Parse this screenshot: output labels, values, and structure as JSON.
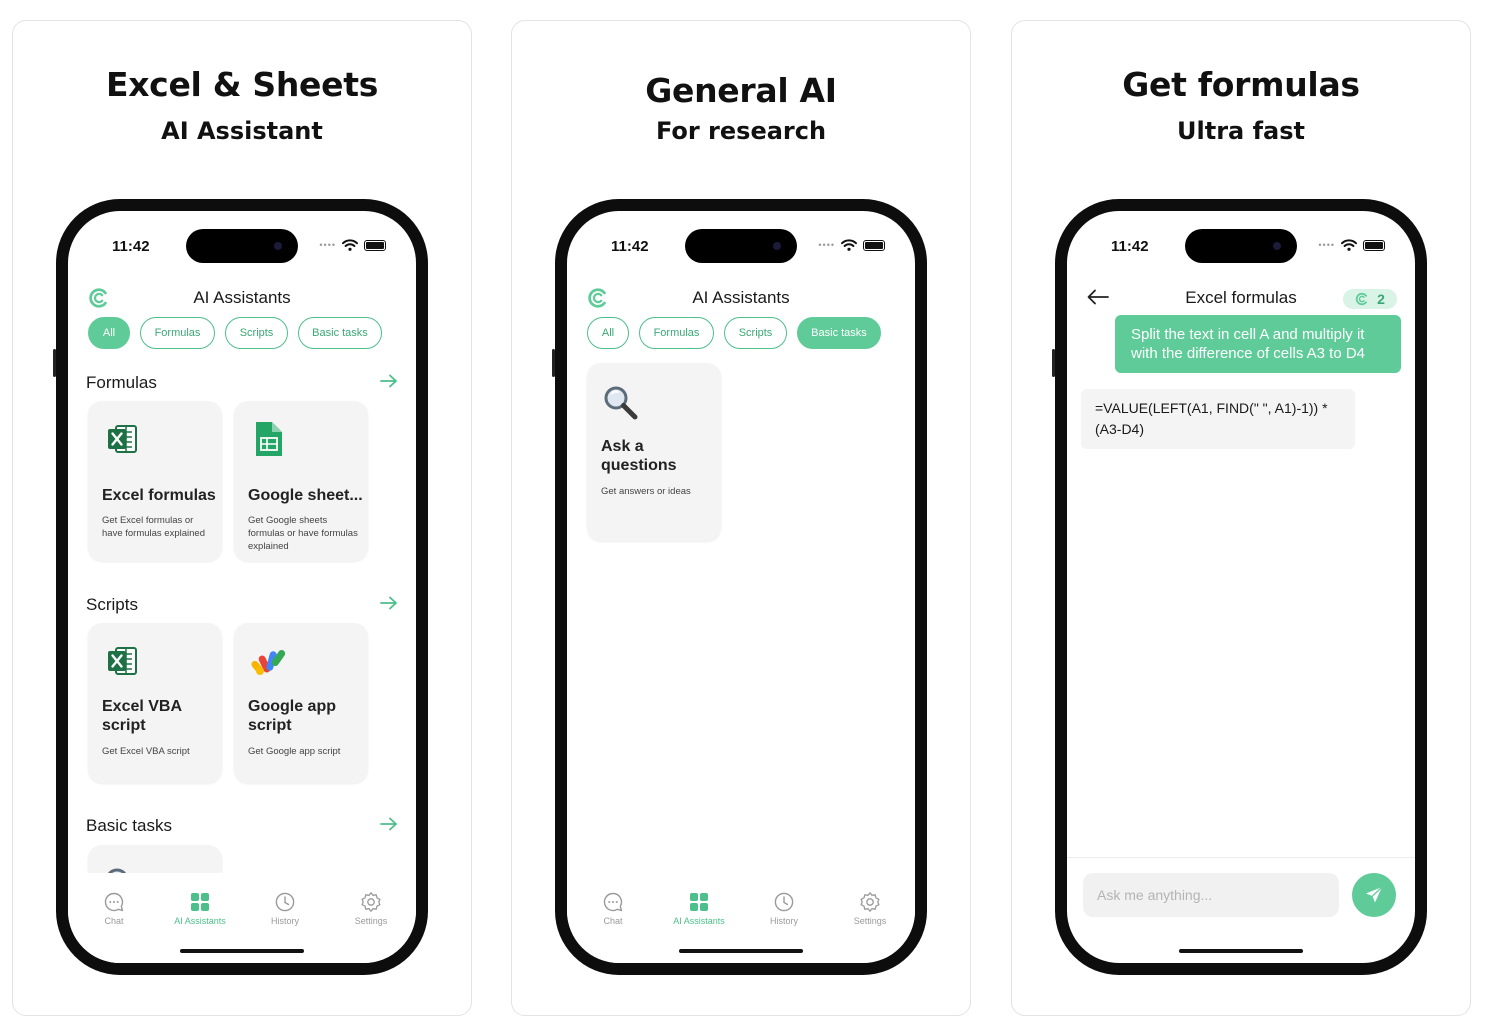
{
  "colors": {
    "accent": "#5ecb98",
    "accent_dark": "#3aa876",
    "tile_bg": "#f4f4f4"
  },
  "status_time": "11:42",
  "panels": [
    {
      "headline": "Excel & Sheets",
      "subheadline": "AI Assistant",
      "screen_title": "AI Assistants",
      "chips": [
        "All",
        "Formulas",
        "Scripts",
        "Basic tasks"
      ],
      "active_chip": "All",
      "sections": [
        {
          "title": "Formulas",
          "tiles": [
            {
              "icon": "excel-icon",
              "title": "Excel formulas",
              "desc": "Get Excel formulas or have formulas explained"
            },
            {
              "icon": "google-sheets-icon",
              "title": "Google sheet...",
              "desc": "Get Google sheets formulas or have formulas explained"
            }
          ]
        },
        {
          "title": "Scripts",
          "tiles": [
            {
              "icon": "excel-icon",
              "title": "Excel VBA script",
              "desc": "Get Excel VBA script"
            },
            {
              "icon": "google-apps-script-icon",
              "title": "Google app script",
              "desc": "Get Google app script"
            }
          ]
        },
        {
          "title": "Basic tasks",
          "tiles": []
        }
      ]
    },
    {
      "headline": "General AI",
      "subheadline": "For research",
      "screen_title": "AI Assistants",
      "chips": [
        "All",
        "Formulas",
        "Scripts",
        "Basic tasks"
      ],
      "active_chip": "Basic tasks",
      "tiles": [
        {
          "icon": "magnifier-icon",
          "title": "Ask a questions",
          "desc": "Get answers or ideas"
        }
      ]
    },
    {
      "headline": "Get formulas",
      "subheadline": "Ultra fast",
      "screen_title": "Excel formulas",
      "credits": "2",
      "user_message": "Split the text in cell A and multiply it with the difference of cells A3 to D4",
      "bot_message": "=VALUE(LEFT(A1, FIND(\" \", A1)-1)) * (A3-D4)",
      "input_placeholder": "Ask me anything..."
    }
  ],
  "tabbar": [
    {
      "label": "Chat",
      "icon": "chat-bubble-icon"
    },
    {
      "label": "AI Assistants",
      "icon": "grid-icon"
    },
    {
      "label": "History",
      "icon": "clock-icon"
    },
    {
      "label": "Settings",
      "icon": "gear-icon"
    }
  ]
}
